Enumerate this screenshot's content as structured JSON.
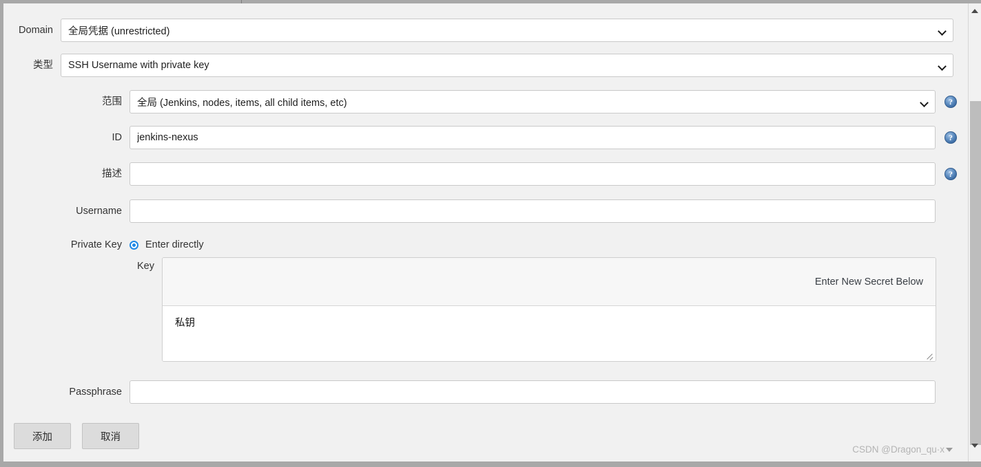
{
  "form": {
    "domain": {
      "label": "Domain",
      "value": "全局凭据 (unrestricted)",
      "icon": "chevron-down-icon"
    },
    "type": {
      "label": "类型",
      "value": "SSH Username with private key",
      "icon": "chevron-down-icon"
    },
    "scope": {
      "label": "范围",
      "value": "全局 (Jenkins, nodes, items, all child items, etc)",
      "icon": "chevron-down-icon",
      "help": "?"
    },
    "id": {
      "label": "ID",
      "value": "jenkins-nexus",
      "placeholder": "",
      "help": "?"
    },
    "description": {
      "label": "描述",
      "value": "",
      "placeholder": "",
      "help": "?"
    },
    "username": {
      "label": "Username",
      "value": "",
      "placeholder": ""
    },
    "private_key": {
      "label": "Private Key",
      "radio_label": "Enter directly",
      "radio_checked": true,
      "key_label": "Key",
      "secret_header": "Enter New Secret Below",
      "secret_value": "私钥"
    },
    "passphrase": {
      "label": "Passphrase",
      "value": "",
      "placeholder": ""
    }
  },
  "actions": {
    "submit_label": "添加",
    "cancel_label": "取消"
  },
  "scrollbar": {
    "up_icon": "triangle-up-icon",
    "down_icon": "triangle-down-icon"
  },
  "watermark": {
    "text": "CSDN @Dragon_qu·x"
  },
  "colors": {
    "page_bg": "#f1f1f1",
    "accent_radio": "#1e88e5",
    "help_icon": "#3c6ba3",
    "button_bg": "#dcdcdc"
  }
}
